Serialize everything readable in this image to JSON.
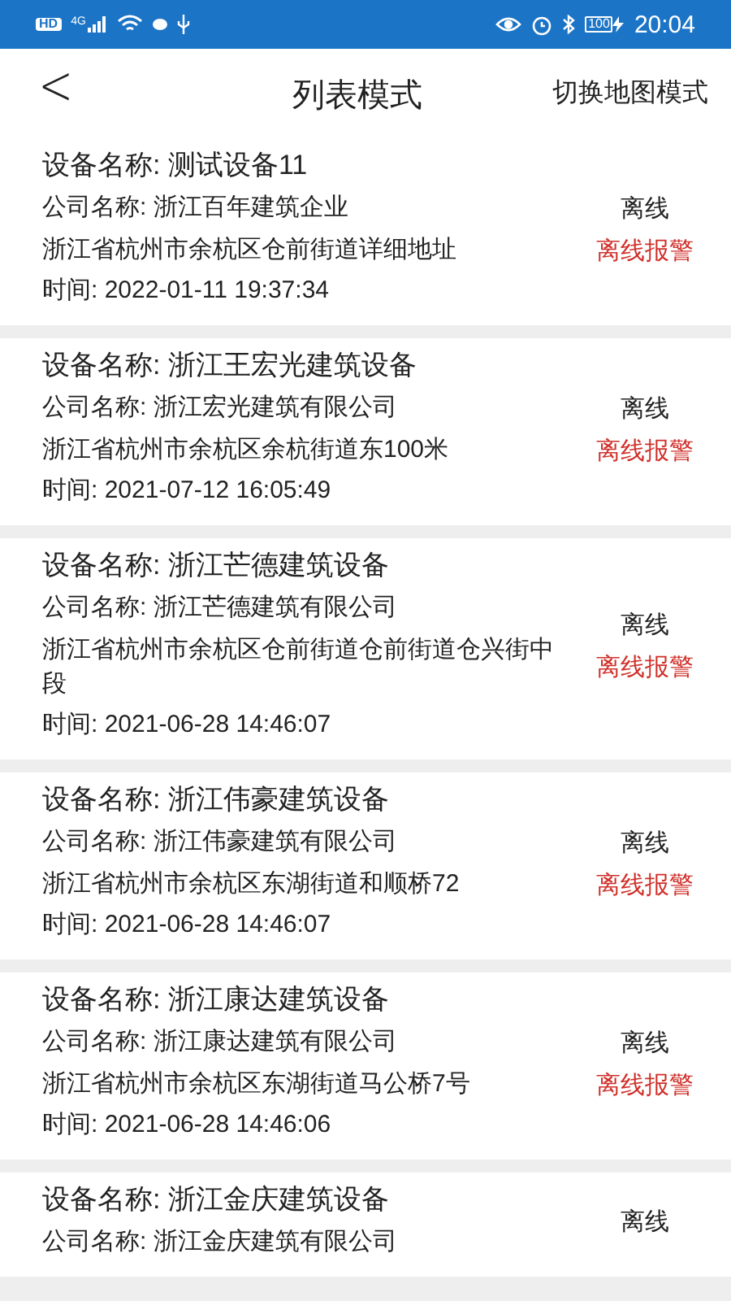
{
  "status_bar": {
    "hd": "HD",
    "network": "4G",
    "battery": "100",
    "time": "20:04"
  },
  "header": {
    "back": "<",
    "title": "列表模式",
    "action": "切换地图模式"
  },
  "devices": [
    {
      "name": "设备名称: 测试设备11",
      "company": "公司名称: 浙江百年建筑企业",
      "address": "浙江省杭州市余杭区仓前街道详细地址",
      "time": "时间: 2022-01-11 19:37:34",
      "status": "离线",
      "alarm": "离线报警"
    },
    {
      "name": "设备名称: 浙江王宏光建筑设备",
      "company": "公司名称: 浙江宏光建筑有限公司",
      "address": "浙江省杭州市余杭区余杭街道东100米",
      "time": "时间: 2021-07-12 16:05:49",
      "status": "离线",
      "alarm": "离线报警"
    },
    {
      "name": "设备名称: 浙江芒德建筑设备",
      "company": "公司名称: 浙江芒德建筑有限公司",
      "address": "浙江省杭州市余杭区仓前街道仓前街道仓兴街中段",
      "time": "时间: 2021-06-28 14:46:07",
      "status": "离线",
      "alarm": "离线报警"
    },
    {
      "name": "设备名称: 浙江伟豪建筑设备",
      "company": "公司名称: 浙江伟豪建筑有限公司",
      "address": "浙江省杭州市余杭区东湖街道和顺桥72",
      "time": "时间: 2021-06-28 14:46:07",
      "status": "离线",
      "alarm": "离线报警"
    },
    {
      "name": "设备名称: 浙江康达建筑设备",
      "company": "公司名称: 浙江康达建筑有限公司",
      "address": "浙江省杭州市余杭区东湖街道马公桥7号",
      "time": "时间: 2021-06-28 14:46:06",
      "status": "离线",
      "alarm": "离线报警"
    },
    {
      "name": "设备名称: 浙江金庆建筑设备",
      "company": "公司名称: 浙江金庆建筑有限公司",
      "status": "离线"
    }
  ]
}
